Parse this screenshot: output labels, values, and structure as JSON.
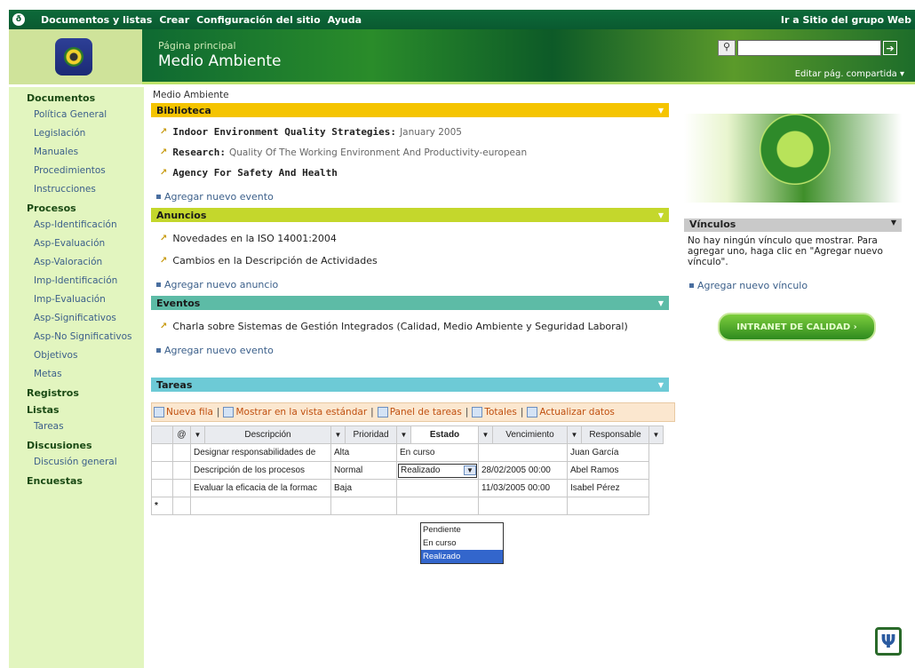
{
  "topbar": {
    "menu": [
      "Documentos y listas",
      "Crear",
      "Configuración del sitio",
      "Ayuda"
    ],
    "right": "Ir a Sitio del grupo Web"
  },
  "banner": {
    "subtitle": "Página principal",
    "site": "Medio Ambiente",
    "editar": "Editar pág. compartida ▾"
  },
  "leftnav": [
    {
      "label": "Documentos",
      "sec": true
    },
    {
      "label": "Política General"
    },
    {
      "label": "Legislación"
    },
    {
      "label": "Manuales"
    },
    {
      "label": "Procedimientos"
    },
    {
      "label": "Instrucciones"
    },
    {
      "label": "Procesos",
      "sec": true
    },
    {
      "label": "Asp-Identificación"
    },
    {
      "label": "Asp-Evaluación"
    },
    {
      "label": "Asp-Valoración"
    },
    {
      "label": "Imp-Identificación"
    },
    {
      "label": "Imp-Evaluación"
    },
    {
      "label": "Asp-Significativos"
    },
    {
      "label": "Asp-No Significativos"
    },
    {
      "label": "Objetivos"
    },
    {
      "label": "Metas"
    },
    {
      "label": "Registros",
      "sec": true
    },
    {
      "label": "Listas",
      "sec": true
    },
    {
      "label": "Tareas"
    },
    {
      "label": "Discusiones",
      "sec": true
    },
    {
      "label": "Discusión general"
    },
    {
      "label": "Encuestas",
      "sec": true
    }
  ],
  "main": {
    "crumb": "Medio Ambiente",
    "biblioteca": {
      "title": "Biblioteca",
      "items": [
        {
          "bold": "Indoor Environment Quality Strategies:",
          "rest": "January 2005"
        },
        {
          "bold": "Research:",
          "rest": "Quality Of The Working Environment And Productivity-european"
        },
        {
          "bold": "Agency For Safety And Health",
          "rest": ""
        }
      ],
      "add": "Agregar nuevo evento"
    },
    "anuncios": {
      "title": "Anuncios",
      "items": [
        "Novedades en la ISO 14001:2004",
        "Cambios en la Descripción  de  Actividades"
      ],
      "add": "Agregar nuevo anuncio"
    },
    "eventos": {
      "title": "Eventos",
      "items": [
        "Charla sobre Sistemas de Gestión Integrados (Calidad, Medio Ambiente y Seguridad Laboral)"
      ],
      "add": "Agregar nuevo evento"
    },
    "tareas": {
      "title": "Tareas"
    },
    "toolbar": [
      "Nueva fila",
      "Mostrar en la vista estándar",
      "Panel de tareas",
      "Totales",
      "Actualizar datos"
    ],
    "columns": [
      "Descripción",
      "Prioridad",
      "Estado",
      "Vencimiento",
      "Responsable"
    ],
    "rows": [
      [
        "Designar responsabilidades de",
        "Alta",
        "En curso",
        "",
        "Juan García"
      ],
      [
        "Descripción de los procesos",
        "Normal",
        "Realizado",
        "28/02/2005 00:00",
        "Abel Ramos"
      ],
      [
        "Evaluar la eficacia de la formac",
        "Baja",
        "",
        "11/03/2005 00:00",
        "Isabel Pérez"
      ]
    ],
    "newrow": "*",
    "dropdown": [
      "Pendiente",
      "En curso",
      "Realizado"
    ]
  },
  "right": {
    "vinculos": "Vínculos",
    "vintxt": "No hay ningún vínculo que mostrar. Para agregar uno, haga clic en \"Agregar nuevo vínculo\".",
    "add": "Agregar nuevo vínculo",
    "intranet": "INTRANET DE CALIDAD ›"
  },
  "colors": {
    "topbar": "#0a5a30",
    "nav": "#e2f5bf",
    "yellow": "#f5c400",
    "lime": "#c4d72c",
    "teal": "#5dbba6",
    "cyan": "#6dcad6"
  },
  "icons": [
    "search-icon",
    "go-icon",
    "psi-icon"
  ]
}
